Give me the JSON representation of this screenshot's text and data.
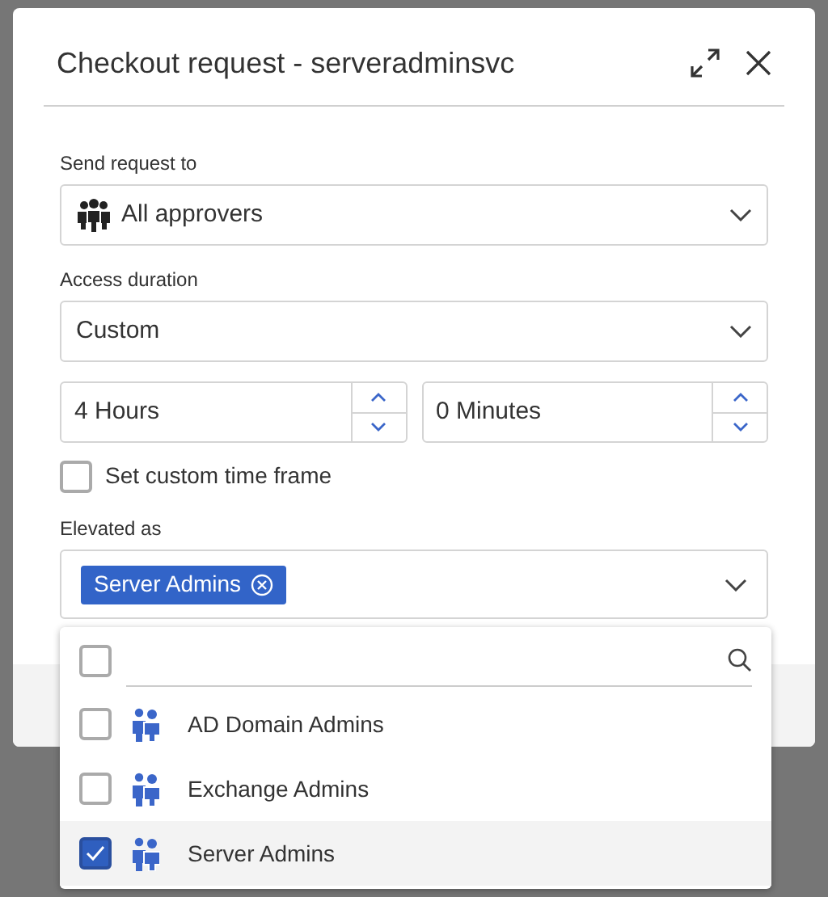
{
  "dialog": {
    "title": "Checkout request - serveradminsvc",
    "send_request_to": {
      "label": "Send request to",
      "value": "All approvers"
    },
    "access_duration": {
      "label": "Access duration",
      "value": "Custom"
    },
    "hours": {
      "value": "4 Hours"
    },
    "minutes": {
      "value": "0 Minutes"
    },
    "custom_time_frame": {
      "label": "Set custom time frame",
      "checked": false
    },
    "elevated_as": {
      "label": "Elevated as",
      "tags": [
        {
          "label": "Server Admins"
        }
      ]
    },
    "dropdown": {
      "select_all_checked": false,
      "options": [
        {
          "label": "AD Domain Admins",
          "checked": false,
          "highlighted": false
        },
        {
          "label": "Exchange Admins",
          "checked": false,
          "highlighted": false
        },
        {
          "label": "Server Admins",
          "checked": true,
          "highlighted": true
        }
      ]
    }
  }
}
